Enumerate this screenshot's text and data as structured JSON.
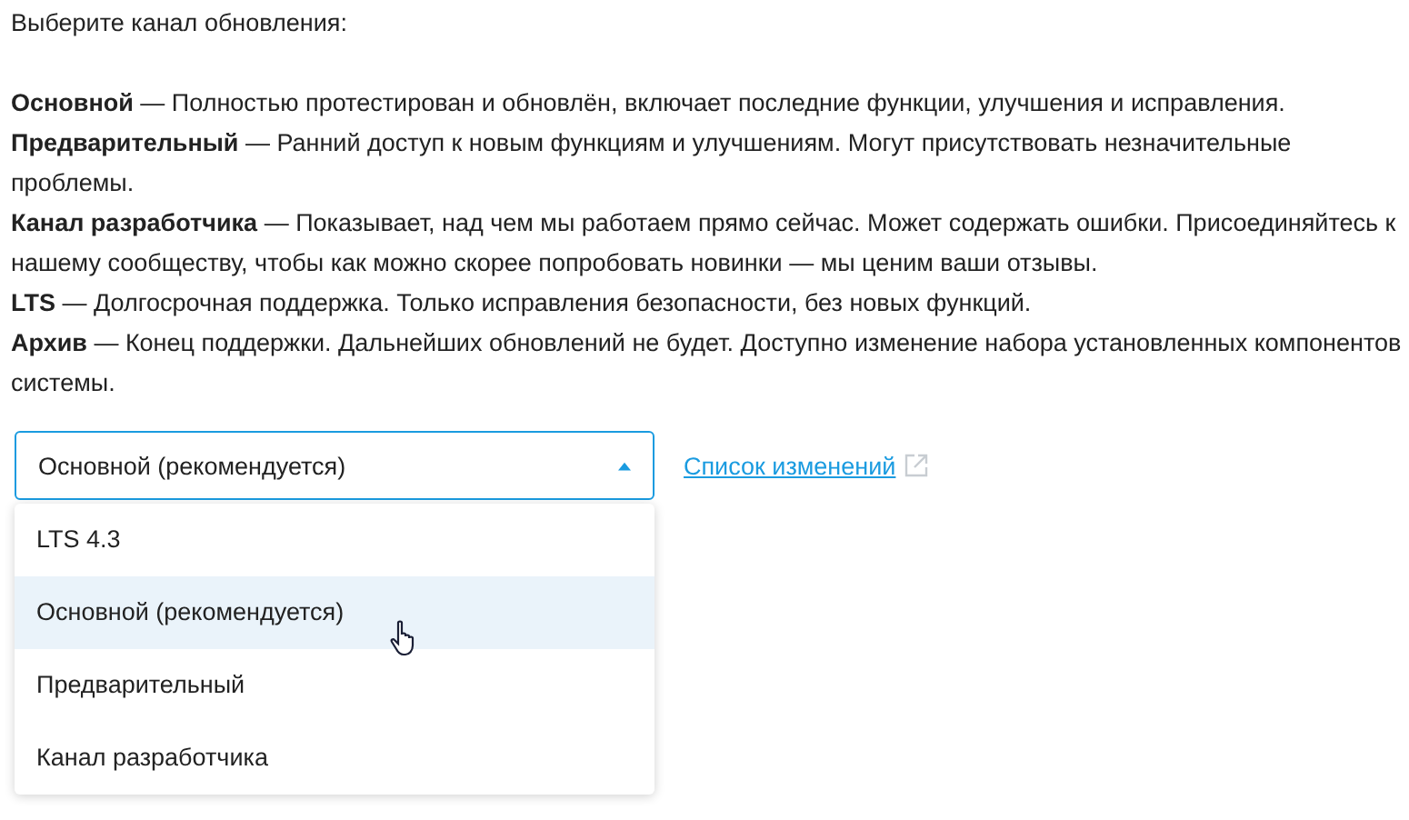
{
  "prompt": "Выберите канал обновления:",
  "descriptions": [
    "**Основной** — Полностью протестирован и обновлён, включает последние функции, улучшения и исправления.",
    "**Предварительный** — Ранний доступ к новым функциям и улучшениям. Могут присутствовать незначительные проблемы.",
    "**Канал разработчика** — Показывает, над чем мы работаем прямо сейчас. Может содержать ошибки. Присоединяйтесь к нашему сообществу, чтобы как можно скорее попробовать новинки — мы ценим ваши отзывы.",
    "**LTS** — Долгосрочная поддержка. Только исправления безопасности, без новых функций.",
    "**Архив** — Конец поддержки. Дальнейших обновлений не будет. Доступно изменение набора установленных компонентов системы."
  ],
  "dropdown": {
    "value": "Основной (рекомендуется)",
    "expanded": true,
    "options": [
      {
        "label": "LTS 4.3",
        "selected": false
      },
      {
        "label": "Основной (рекомендуется)",
        "selected": true
      },
      {
        "label": "Предварительный",
        "selected": false
      },
      {
        "label": "Канал разработчика",
        "selected": false
      }
    ]
  },
  "changelog_link": "Список изменений"
}
